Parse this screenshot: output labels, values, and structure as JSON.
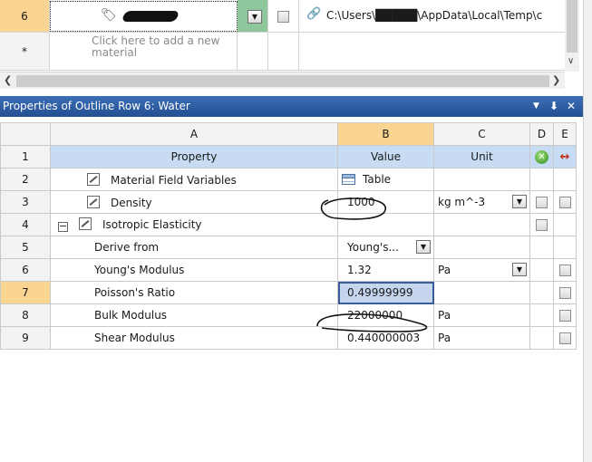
{
  "outline": {
    "row6": {
      "number": "6",
      "path": "C:\\Users\\█████\\AppData\\Local\\Temp\\c"
    },
    "row_new": {
      "number": "*",
      "placeholder": "Click here to add a new material"
    }
  },
  "panel": {
    "title": "Properties of Outline Row 6: Water",
    "pin_icon": "pin-icon",
    "close_icon": "close-icon"
  },
  "grid": {
    "column_letters": [
      "A",
      "B",
      "C",
      "D",
      "E"
    ],
    "headers": {
      "row": "1",
      "property": "Property",
      "value": "Value",
      "unit": "Unit"
    },
    "rows": [
      {
        "num": "2",
        "property": "Material Field Variables",
        "value": "Table",
        "unit": ""
      },
      {
        "num": "3",
        "property": "Density",
        "value": "1000",
        "unit": "kg m^-3"
      },
      {
        "num": "4",
        "property": "Isotropic Elasticity",
        "value": "",
        "unit": ""
      },
      {
        "num": "5",
        "property": "Derive from",
        "value": "Young's...",
        "unit": ""
      },
      {
        "num": "6",
        "property": "Young's Modulus",
        "value": "1.32",
        "unit": "Pa"
      },
      {
        "num": "7",
        "property": "Poisson's Ratio",
        "value": "0.49999999",
        "unit": ""
      },
      {
        "num": "8",
        "property": "Bulk Modulus",
        "value": "22000000",
        "unit": "Pa"
      },
      {
        "num": "9",
        "property": "Shear Modulus",
        "value": "0.440000003",
        "unit": "Pa"
      }
    ]
  },
  "colors": {
    "title_bar": "#2f5fa6",
    "selected_row_header": "#fad491",
    "header_row": "#c7dcf2",
    "annotation_ink": "#111111"
  }
}
